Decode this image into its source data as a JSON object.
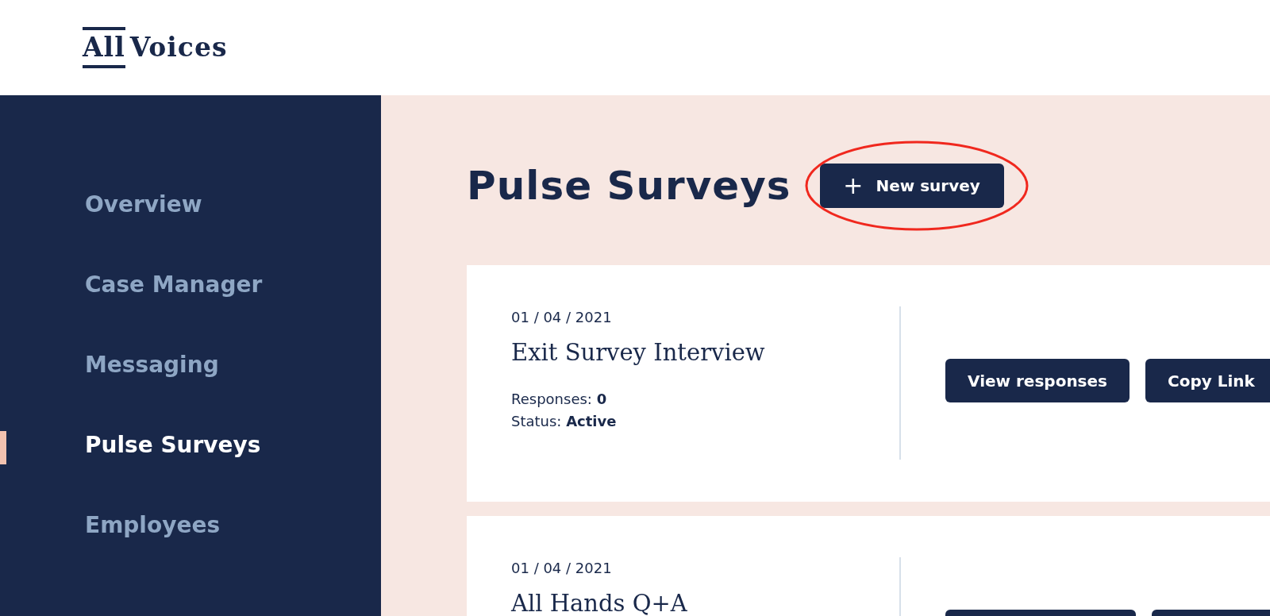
{
  "logo": {
    "text_1": "All",
    "text_2": "Voices"
  },
  "sidebar": {
    "items": [
      {
        "label": "Overview",
        "selected": false
      },
      {
        "label": "Case Manager",
        "selected": false
      },
      {
        "label": "Messaging",
        "selected": false
      },
      {
        "label": "Pulse Surveys",
        "selected": true
      },
      {
        "label": "Employees",
        "selected": false
      }
    ]
  },
  "page": {
    "title": "Pulse Surveys",
    "new_button": {
      "icon": "+",
      "label": "New survey",
      "highlighted": true
    }
  },
  "surveys": [
    {
      "date": "01 / 04 / 2021",
      "title": "Exit Survey Interview",
      "responses_label": "Responses: ",
      "responses": "0",
      "status_label": "Status: ",
      "status": "Active",
      "buttons": [
        {
          "kind": "labeled",
          "label": "View responses"
        },
        {
          "kind": "labeled",
          "label": "Copy Link"
        }
      ]
    },
    {
      "date": "01 / 04 / 2021",
      "title": "All Hands Q+A",
      "buttons": [
        {
          "kind": "hidden"
        },
        {
          "kind": "hidden"
        }
      ]
    }
  ]
}
